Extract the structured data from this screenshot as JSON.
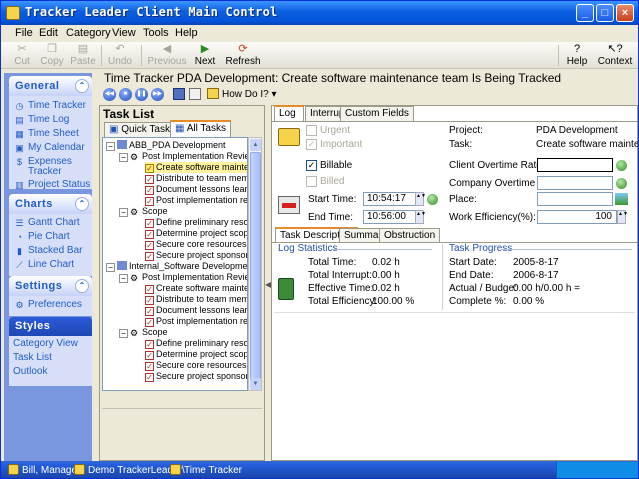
{
  "window": {
    "title": "Tracker Leader Client Main Control",
    "min_label": "_",
    "max_label": "□",
    "close_label": "×"
  },
  "menu": [
    "File",
    "Edit",
    "Category",
    "View",
    "Tools",
    "Help"
  ],
  "toolbar": {
    "cut": "Cut",
    "copy": "Copy",
    "paste": "Paste",
    "undo": "Undo",
    "previous": "Previous",
    "next": "Next",
    "refresh": "Refresh",
    "help": "Help",
    "context": "Context"
  },
  "sidebar": {
    "general": {
      "title": "General",
      "items": [
        "Time Tracker",
        "Time Log",
        "Time Sheet",
        "My Calendar",
        "Expenses",
        "Tracker",
        "Project Status"
      ]
    },
    "charts": {
      "title": "Charts",
      "items": [
        "Gantt Chart",
        "Pie Chart",
        "Stacked Bar",
        "Line Chart"
      ]
    },
    "settings": {
      "title": "Settings",
      "items": [
        "Preferences"
      ]
    },
    "styles": {
      "title": "Styles",
      "items": [
        "Category View",
        "Task List",
        "Outlook"
      ]
    }
  },
  "header": {
    "title": "Time Tracker   PDA Development: Create software maintenance team Is Being Tracked",
    "how_do_i": "How Do I?"
  },
  "task_list": {
    "title": "Task List",
    "tabs": [
      "Quick Tasks",
      "All Tasks"
    ],
    "tree": [
      "ABB_PDA Development",
      "Post Implementation Review",
      "Create software maintena",
      "Distribute to team member",
      "Document lessons learne",
      "Post implementation revie",
      "Scope",
      "Define preliminary resourc",
      "Determine project scope",
      "Secure core resources",
      "Secure project sponsorsh",
      "Internal_Software Development",
      "Post Implementation Review",
      "Create software maintena",
      "Distribute to team member",
      "Document lessons learne",
      "Post implementation revie",
      "Scope",
      "Define preliminary resourc",
      "Determine project scope",
      "Secure core resources",
      "Secure project sponsorsh"
    ]
  },
  "detail": {
    "tabs": [
      "Log",
      "Interrupt",
      "Custom Fields"
    ],
    "urgent": "Urgent",
    "important": "Important",
    "billable": "Billable",
    "billed": "Billed",
    "project_label": "Project:",
    "project_value": "PDA Development",
    "task_label": "Task:",
    "task_value": "Create software maintenance",
    "client_overtime_label": "Client Overtime Rate:",
    "client_overtime_value": "",
    "company_overtime_label": "Company Overtime Rate:",
    "company_overtime_value": "",
    "start_time_label": "Start Time:",
    "start_time_value": "10:54:17",
    "end_time_label": "End Time:",
    "end_time_value": "10:56:00",
    "place_label": "Place:",
    "place_value": "",
    "efficiency_label": "Work Efficiency(%):",
    "efficiency_value": "100",
    "sub_tabs": [
      "Task Description",
      "Summary",
      "Obstruction"
    ],
    "log_stats": {
      "title": "Log Statistics",
      "rows": [
        {
          "label": "Total Time:",
          "value": "0.02 h"
        },
        {
          "label": "Total Interrupt:",
          "value": "0.00 h"
        },
        {
          "label": "Effective Time:",
          "value": "0.02 h"
        },
        {
          "label": "Total Efficiency:",
          "value": "100.00 %"
        }
      ]
    },
    "task_progress": {
      "title": "Task Progress",
      "rows": [
        {
          "label": "Start Date:",
          "value": "2005-8-17"
        },
        {
          "label": "End Date:",
          "value": "2006-8-17"
        },
        {
          "label": "Actual / Budge:",
          "value": "0.00 h/0.00 h ="
        },
        {
          "label": "Complete %:",
          "value": "0.00 %"
        }
      ]
    }
  },
  "taskbar": {
    "items": [
      "Bill, Manager",
      "Demo TrackerLeader\\",
      "Time Tracker"
    ]
  },
  "colors": {
    "title_blue": "#0a5fe0",
    "link_blue": "#215dc6",
    "section_blue": "#2050b0",
    "tab_accent": "#e68b2c"
  }
}
